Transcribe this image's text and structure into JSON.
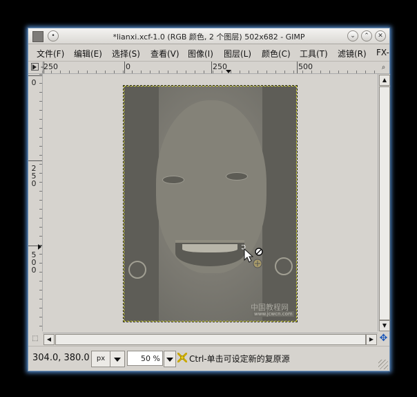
{
  "window": {
    "title": "*lianxi.xcf-1.0 (RGB 颜色, 2 个图层) 502x682 - GIMP",
    "controls": [
      "⌄",
      "⌃",
      "✕"
    ]
  },
  "menu": [
    "文件(F)",
    "编辑(E)",
    "选择(S)",
    "查看(V)",
    "图像(I)",
    "图层(L)",
    "颜色(C)",
    "工具(T)",
    "滤镜(R)",
    "FX-"
  ],
  "ruler": {
    "h_labels": [
      "-250",
      "0",
      "250",
      "500"
    ],
    "v_labels": [
      "0",
      "250",
      "500"
    ]
  },
  "canvas": {
    "watermark": "中国教程网",
    "watermark_url": "www.jcwcn.com"
  },
  "status": {
    "coords": "304.0, 380.0",
    "unit": "px",
    "zoom": "50 %",
    "hint": "Ctrl-单击可设定新的复原源"
  },
  "icons": {
    "corner": "navigation-toggle-icon",
    "zoom_fit": "zoom-to-fit-icon",
    "quick_mask": "quick-mask-icon",
    "navigate": "navigate-icon",
    "hint": "clone-tool-icon",
    "cursor": "clone-cursor-icon"
  },
  "colors": {
    "accent": "#4f86c6",
    "selection_border": "#d7d73a"
  }
}
